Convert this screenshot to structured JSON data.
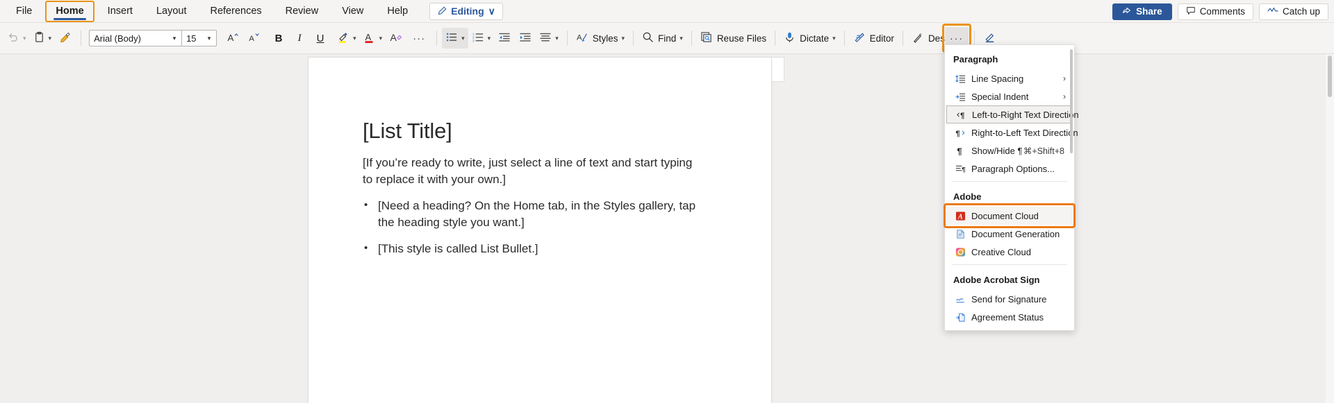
{
  "tabs": [
    {
      "label": "File",
      "active": false
    },
    {
      "label": "Home",
      "active": true
    },
    {
      "label": "Insert",
      "active": false
    },
    {
      "label": "Layout",
      "active": false
    },
    {
      "label": "References",
      "active": false
    },
    {
      "label": "Review",
      "active": false
    },
    {
      "label": "View",
      "active": false
    },
    {
      "label": "Help",
      "active": false
    }
  ],
  "editing_button": {
    "label": "Editing",
    "icon": "pencil-icon",
    "caret": "∨"
  },
  "titlebar_right": {
    "share": "Share",
    "comments": "Comments",
    "catch_up": "Catch up"
  },
  "ribbon": {
    "undo": "undo-icon",
    "paste": "paste-icon",
    "format_painter": "format-painter-icon",
    "font_name": "Arial (Body)",
    "font_size": "15",
    "grow_font": "A˄",
    "shrink_font": "A˅",
    "bold": "B",
    "italic": "I",
    "underline": "U",
    "highlight": "highlight-icon",
    "font_color": "font-color-icon",
    "clear_formatting": "clear-formatting-icon",
    "more_font": "···",
    "bullets": "bullets-icon",
    "numbering": "numbering-icon",
    "decrease_indent": "decrease-indent-icon",
    "increase_indent": "increase-indent-icon",
    "align": "align-icon",
    "styles": "Styles",
    "find": "Find",
    "reuse_files": "Reuse Files",
    "dictate": "Dictate",
    "editor": "Editor",
    "designer": "Designer",
    "draw": "draw-icon",
    "more_options": "···",
    "collapse_ribbon": "∨"
  },
  "document": {
    "title": "[List Title]",
    "paragraph": "[If you’re ready to write, just select a line of text and start typing to replace it with your own.]",
    "bullets": [
      "[Need a heading? On the Home tab, in the Styles gallery, tap the heading style you want.]",
      "[This style is called List Bullet.]"
    ]
  },
  "menu": {
    "sections": [
      {
        "header": "Paragraph",
        "items": [
          {
            "label": "Line Spacing",
            "icon": "line-spacing-icon",
            "submenu": "›",
            "state": "normal"
          },
          {
            "label": "Special Indent",
            "icon": "special-indent-icon",
            "submenu": "›",
            "state": "normal"
          },
          {
            "label": "Left-to-Right Text Direction",
            "icon": "ltr-text-direction-icon",
            "state": "hovered"
          },
          {
            "label": "Right-to-Left Text Direction",
            "icon": "rtl-text-direction-icon",
            "state": "normal"
          },
          {
            "label": "Show/Hide ¶",
            "icon": "pilcrow-icon",
            "shortcut": "⌘+Shift+8",
            "state": "normal"
          },
          {
            "label": "Paragraph Options...",
            "icon": "paragraph-options-icon",
            "state": "normal"
          }
        ]
      },
      {
        "header": "Adobe",
        "items": [
          {
            "label": "Document Cloud",
            "icon": "adobe-acrobat-icon",
            "state": "highlighted"
          },
          {
            "label": "Document Generation",
            "icon": "document-generation-icon",
            "state": "normal"
          },
          {
            "label": "Creative Cloud",
            "icon": "creative-cloud-icon",
            "state": "normal"
          }
        ]
      },
      {
        "header": "Adobe Acrobat Sign",
        "items": [
          {
            "label": "Send for Signature",
            "icon": "signature-icon",
            "state": "normal"
          },
          {
            "label": "Agreement Status",
            "icon": "agreement-status-icon",
            "state": "normal"
          }
        ]
      }
    ]
  },
  "colors": {
    "accent_blue": "#2b579a",
    "highlight_orange": "#eb9316",
    "adobe_red": "#d32d1f",
    "ribbon_bg": "#f5f4f3"
  }
}
